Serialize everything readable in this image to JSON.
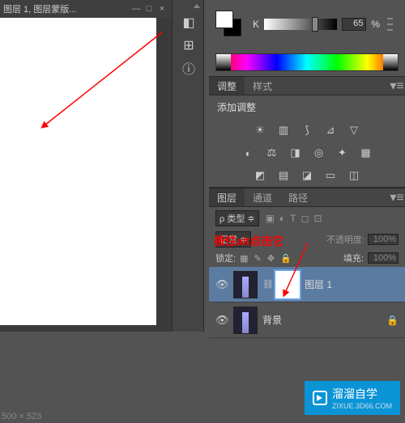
{
  "document": {
    "tab_title": "图层 1, 图层蒙版..."
  },
  "color": {
    "channel_label": "K",
    "value": "65",
    "percent": "%"
  },
  "adjustments": {
    "tab_active": "调整",
    "tab_styles": "样式",
    "add_label": "添加调整"
  },
  "layers": {
    "tab_layers": "图层",
    "tab_channels": "通道",
    "tab_paths": "路径",
    "kind_label": "ρ 类型",
    "blend_mode": "正常",
    "opacity_label": "不透明度:",
    "opacity_value": "100%",
    "lock_label": "锁定:",
    "fill_label": "填充:",
    "fill_value": "100%",
    "items": [
      {
        "name": "图层 1",
        "has_mask": true,
        "locked": false
      },
      {
        "name": "背景",
        "has_mask": false,
        "locked": true
      }
    ]
  },
  "annotation": {
    "text": "按住alt点击它"
  },
  "watermark": {
    "brand": "溜溜自学",
    "url": "ZIXUE.3D66.COM"
  },
  "dimensions": "500 × 523"
}
